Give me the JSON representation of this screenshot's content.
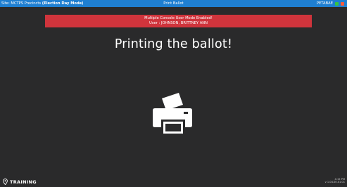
{
  "topbar": {
    "site_label": "Site: MCTPS Precincts",
    "mode_label": "(Election Day Mode)",
    "screen_title": "Print Ballot",
    "device_id": "PETABAE",
    "status_colors": {
      "ok": "#37c43f",
      "alert": "#ff5a3b"
    }
  },
  "banner": {
    "line1": "Multiple Console User Mode Enabled!",
    "line2": "User : JOHNSON, BRITTNEY ANN",
    "color": "#d0343c"
  },
  "main": {
    "headline": "Printing the ballot!",
    "icon": "printer-icon"
  },
  "footer": {
    "training_label": "TRAINING",
    "training_icon": "location-pin-icon",
    "time": "4:15 PM",
    "version": "v 1.04.00.01.01"
  },
  "colors": {
    "topbar": "#1f7fd1",
    "background": "#2a2a2b"
  }
}
